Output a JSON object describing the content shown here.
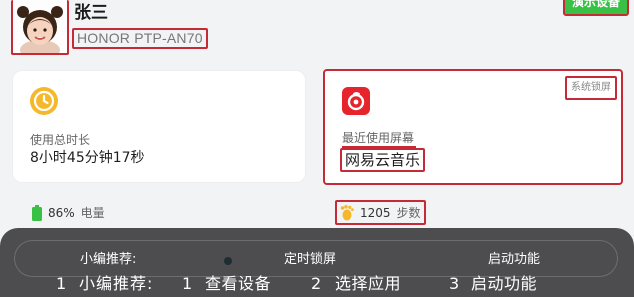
{
  "colors": {
    "accent_green": "#39c145",
    "highlight_red": "#c62a36",
    "clock_yellow": "#f5b82a",
    "netease_red": "#e5242b",
    "overlay_gray": "#4d4d50"
  },
  "header": {
    "user_name": "张三",
    "device_model": "HONOR PTP-AN70",
    "demo_button_label": "演示设备",
    "avatar_icon": "child-avatar"
  },
  "usage_card": {
    "icon": "clock-icon",
    "label": "使用总时长",
    "value": "8小时45分钟17秒"
  },
  "recent_card": {
    "icon": "netease-music-icon",
    "tag": "系统锁屏",
    "label": "最近使用屏幕",
    "app_name": "网易云音乐"
  },
  "stats": {
    "battery_value": "86%",
    "battery_unit": "电量",
    "steps_value": "1205",
    "steps_unit": "步数"
  },
  "onboarding": {
    "titles": [
      "小编推荐:",
      "定时锁屏",
      "启动功能"
    ],
    "steps": [
      {
        "num": "1",
        "label": "小编推荐:"
      },
      {
        "num": "1",
        "label": "查看设备"
      },
      {
        "num": "2",
        "label": "选择应用"
      },
      {
        "num": "3",
        "label": "启动功能"
      }
    ]
  }
}
